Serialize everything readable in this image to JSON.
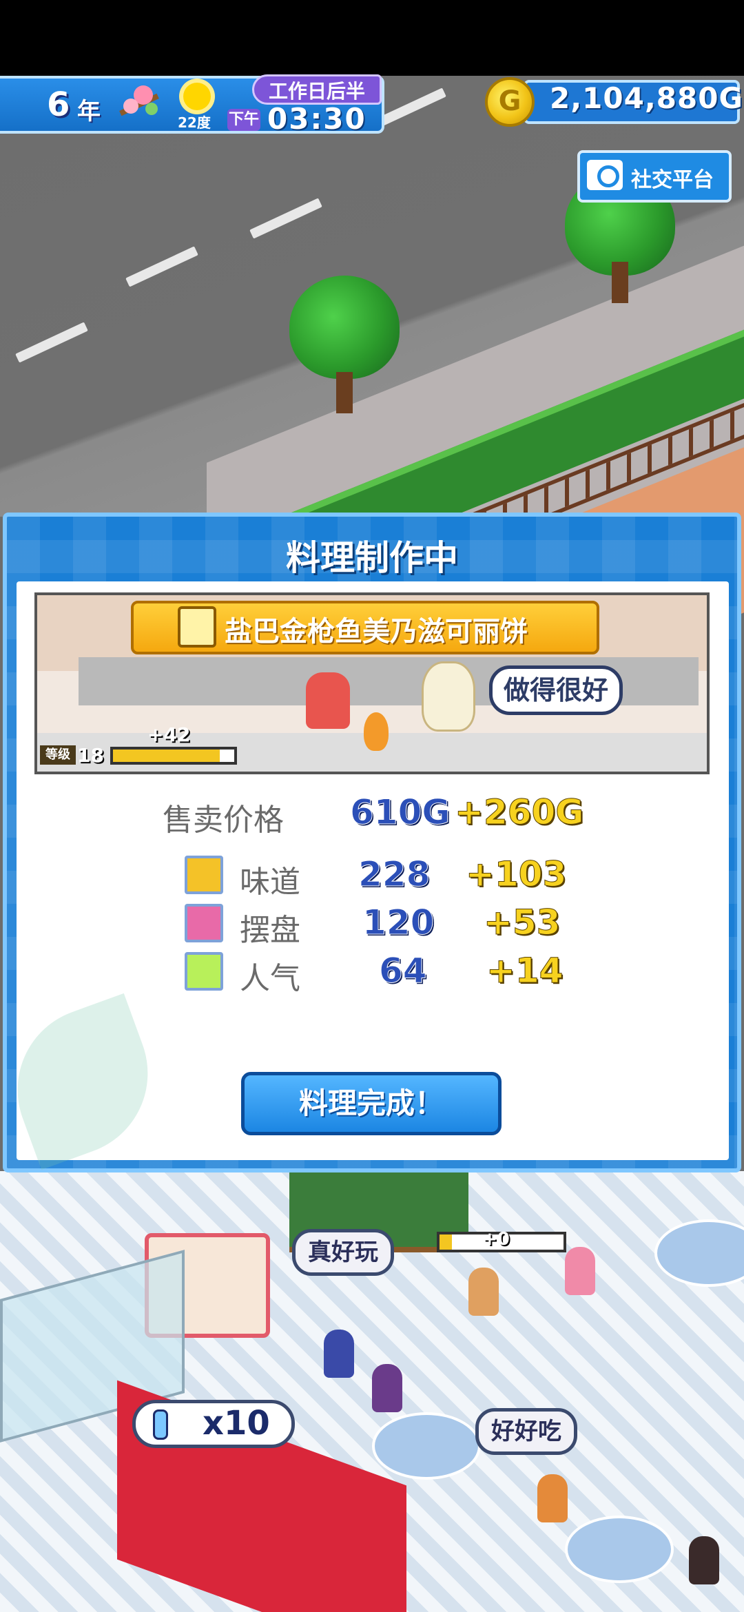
{
  "hud": {
    "year_num": "6",
    "year_unit": "年",
    "temperature": "22度",
    "day_phase": "工作日后半",
    "ampm": "下午",
    "time": "03:30",
    "gold": "2,104,880G",
    "coin_symbol": "G"
  },
  "social_button": {
    "label": "社交平台"
  },
  "dialog": {
    "title": "料理制作中",
    "dish_name": "盐巴金枪鱼美乃滋可丽饼",
    "praise": "做得很好",
    "level": {
      "tag": "等级",
      "value": "18",
      "gain": "+42",
      "progress": 0.88
    },
    "price": {
      "label": "售卖价格",
      "value": "610G",
      "bonus": "+260G"
    },
    "stats": [
      {
        "icon": "taste-face-icon",
        "label": "味道",
        "value": "228",
        "bonus": "+103"
      },
      {
        "icon": "presentation-icon",
        "label": "摆盘",
        "value": "120",
        "bonus": "+53"
      },
      {
        "icon": "popularity-icon",
        "label": "人气",
        "value": "64",
        "bonus": "+14"
      }
    ],
    "done_button": "料理完成！"
  },
  "world": {
    "bubbles": [
      "真好玩",
      "好好吃"
    ],
    "counter": "x10",
    "progress_label": "+0",
    "progress": 0.1
  },
  "colors": {
    "hud_blue": "#1e77d3",
    "dialog_blue": "#1a7fd6",
    "gold": "#f7d21f",
    "button_blue": "#1c86e3"
  }
}
